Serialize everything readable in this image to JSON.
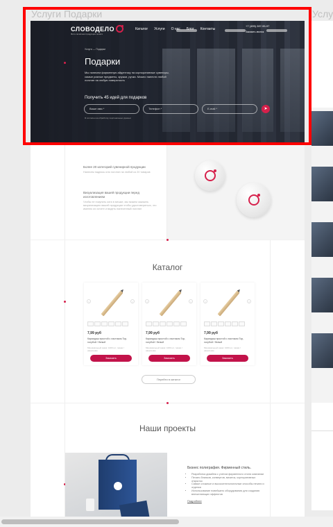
{
  "canvas": {
    "board_title": "Услуги Подарки",
    "board_title_2": "Услуги"
  },
  "header": {
    "logo_text": "СЛОВОДЕЛО",
    "logo_sub": "Фото‑печатная продукция печати",
    "nav": [
      "Каталог",
      "Услуги",
      "О нас",
      "Блог",
      "Контакты"
    ],
    "phone": "+7 (495) 287-95-97",
    "callback": "Заказать звонок"
  },
  "hero": {
    "breadcrumb": "Услуги  —  Подарки",
    "title": "Подарки",
    "description": "Мы нанесем фирменную айдентику на корпоративные сувениры, самые разные предметы, кружки, ручки. Можно нанести любой логотип на любую поверхность",
    "form_title": "Получить 45 идей для подарков",
    "name_placeholder": "Ваше имя *",
    "phone_placeholder": "Телефон *",
    "email_placeholder": "E-mail *",
    "send_icon": "arrow-right-icon",
    "consent": "Я согласен на обработку персональных данных"
  },
  "features": [
    {
      "title": "Более 20 категорий сувенирной продукции",
      "text": "Нанесем надпись или логотип на любой из 20 товаров"
    },
    {
      "title": "Визуализация вашей продукции перед изготовлением",
      "text": "Чтобы не покупать кота в мешке, мы можем заказать визуализацию вашей продукции чтобы удостовериться, что именно их хотите и видеть нанесенный логотип"
    }
  ],
  "catalog": {
    "title": "Каталог",
    "to_catalog": "Перейти в каталог",
    "products": [
      {
        "price": "7,99 руб",
        "name": "Карандаш простой с ластиком Тор, голубой / белый",
        "meta": "Минимальный заказ: 1000 шт, тираж / нанесение",
        "order": "Заказать"
      },
      {
        "price": "7,99 руб",
        "name": "Карандаш простой с ластиком Тор, голубой / белый",
        "meta": "Минимальный заказ: 1000 шт, тираж / нанесение",
        "order": "Заказать"
      },
      {
        "price": "7,99 руб",
        "name": "Карандаш простой с ластиком Тор, голубой / белый",
        "meta": "Минимальный заказ: 1000 шт, тираж / нанесение",
        "order": "Заказать"
      }
    ]
  },
  "projects": {
    "title": "Наши проекты",
    "item_title": "Бизнес полиграфия. Фирменный стиль.",
    "bullets": [
      "Разработка дизайна с учетом фирменного стиля компании",
      "Печать бланков, конвертов, визиток, корпоративных открыток",
      "Самые сложные и высокотехнологичные способы печати и отделки",
      "Использование новейшего оборудования для создания впечатляющих эффектов"
    ],
    "more": "Подробнее"
  },
  "colors": {
    "accent": "#d6204b",
    "button": "#c2134a",
    "highlight": "#ff0000"
  }
}
